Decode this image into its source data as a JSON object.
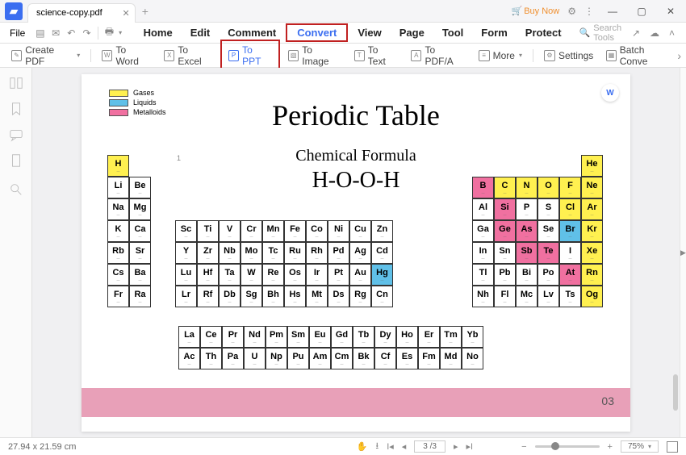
{
  "titlebar": {
    "tab": "science-copy.pdf",
    "buynow": "Buy Now"
  },
  "menubar": {
    "file": "File",
    "items": [
      "Home",
      "Edit",
      "Comment",
      "Convert",
      "View",
      "Page",
      "Tool",
      "Form",
      "Protect"
    ],
    "search": "Search Tools"
  },
  "toolbar": {
    "create": "Create PDF",
    "toword": "To Word",
    "toexcel": "To Excel",
    "toppt": "To PPT",
    "toimage": "To Image",
    "totext": "To Text",
    "topdfa": "To PDF/A",
    "more": "More",
    "settings": "Settings",
    "batch": "Batch Conve"
  },
  "page": {
    "title": "Periodic Table",
    "formula_label": "Chemical Formula",
    "formula": "H-O-O-H",
    "legend": {
      "gases": "Gases",
      "liquids": "Liquids",
      "metalloids": "Metalloids"
    },
    "pagenum": "03",
    "lone": "1"
  },
  "statusbar": {
    "dims": "27.94 x 21.59 cm",
    "page": "3 /3",
    "zoom": "75%"
  },
  "elements": {
    "g1": [
      [
        "H",
        "y"
      ],
      [
        "Li",
        ""
      ],
      [
        "Na",
        ""
      ],
      [
        "K",
        ""
      ],
      [
        "Rb",
        ""
      ],
      [
        "Cs",
        ""
      ],
      [
        "Fr",
        ""
      ]
    ],
    "g2": [
      [
        "Be",
        ""
      ],
      [
        "Mg",
        ""
      ],
      [
        "Ca",
        ""
      ],
      [
        "Sr",
        ""
      ],
      [
        "Ba",
        ""
      ],
      [
        "Ra",
        ""
      ]
    ],
    "dblock": [
      [
        "Sc",
        "Ti",
        "V",
        "Cr",
        "Mn",
        "Fe",
        "Co",
        "Ni",
        "Cu",
        "Zn"
      ],
      [
        "Y",
        "Zr",
        "Nb",
        "Mo",
        "Tc",
        "Ru",
        "Rh",
        "Pd",
        "Ag",
        "Cd"
      ],
      [
        "Lu",
        "Hf",
        "Ta",
        "W",
        "Re",
        "Os",
        "Ir",
        "Pt",
        "Au",
        "Hg"
      ],
      [
        "Lr",
        "Rf",
        "Db",
        "Sg",
        "Bh",
        "Hs",
        "Mt",
        "Ds",
        "Rg",
        "Cn"
      ]
    ],
    "dcolor": {
      "2,9": "b"
    },
    "g13": [
      [
        "B",
        "p"
      ],
      [
        "Al",
        ""
      ],
      [
        "Ga",
        ""
      ],
      [
        "In",
        ""
      ],
      [
        "Tl",
        ""
      ],
      [
        "Nh",
        ""
      ]
    ],
    "g14": [
      [
        "C",
        "y"
      ],
      [
        "Si",
        "p"
      ],
      [
        "Ge",
        "p"
      ],
      [
        "Sn",
        ""
      ],
      [
        "Pb",
        ""
      ],
      [
        "Fl",
        ""
      ]
    ],
    "g15": [
      [
        "N",
        "y"
      ],
      [
        "P",
        ""
      ],
      [
        "As",
        "p"
      ],
      [
        "Sb",
        "p"
      ],
      [
        "Bi",
        ""
      ],
      [
        "Mc",
        ""
      ]
    ],
    "g16": [
      [
        "O",
        "y"
      ],
      [
        "S",
        ""
      ],
      [
        "Se",
        ""
      ],
      [
        "Te",
        "p"
      ],
      [
        "Po",
        ""
      ],
      [
        "Lv",
        ""
      ]
    ],
    "g17": [
      [
        "F",
        "y"
      ],
      [
        "Cl",
        "y"
      ],
      [
        "Br",
        "b"
      ],
      [
        "I",
        ""
      ],
      [
        "At",
        "p"
      ],
      [
        "Ts",
        ""
      ]
    ],
    "g18": [
      [
        "He",
        "y"
      ],
      [
        "Ne",
        "y"
      ],
      [
        "Ar",
        "y"
      ],
      [
        "Kr",
        "y"
      ],
      [
        "Xe",
        "y"
      ],
      [
        "Rn",
        "y"
      ],
      [
        "Og",
        "y"
      ]
    ],
    "fblock": [
      [
        "La",
        "Ce",
        "Pr",
        "Nd",
        "Pm",
        "Sm",
        "Eu",
        "Gd",
        "Tb",
        "Dy",
        "Ho",
        "Er",
        "Tm",
        "Yb"
      ],
      [
        "Ac",
        "Th",
        "Pa",
        "U",
        "Np",
        "Pu",
        "Am",
        "Cm",
        "Bk",
        "Cf",
        "Es",
        "Fm",
        "Md",
        "No"
      ]
    ]
  }
}
